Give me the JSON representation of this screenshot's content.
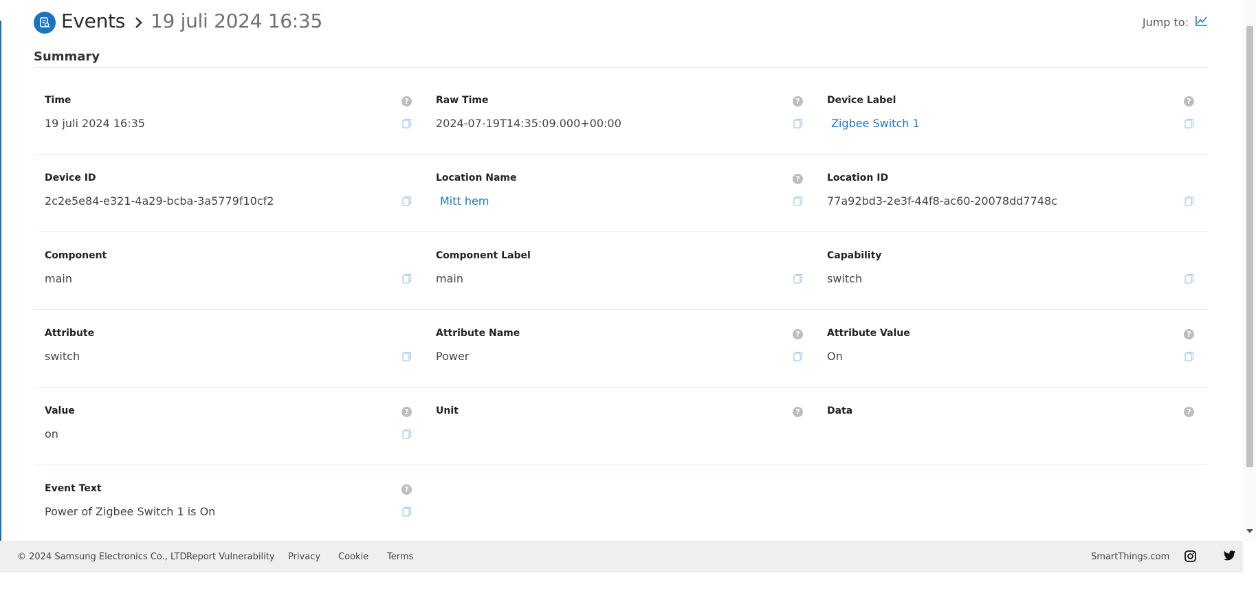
{
  "header": {
    "title": "Events",
    "subtitle": "19 juli 2024 16:35",
    "jump_label": "Jump to:"
  },
  "section": {
    "title": "Summary"
  },
  "fields": [
    [
      {
        "label": "Time",
        "value": "19 juli 2024 16:35",
        "help": true,
        "link": false
      },
      {
        "label": "Raw Time",
        "value": "2024-07-19T14:35:09.000+00:00",
        "help": true,
        "link": false
      },
      {
        "label": "Device Label",
        "value": "Zigbee Switch 1",
        "help": true,
        "link": true
      }
    ],
    [
      {
        "label": "Device ID",
        "value": "2c2e5e84-e321-4a29-bcba-3a5779f10cf2",
        "help": false,
        "link": false
      },
      {
        "label": "Location Name",
        "value": "Mitt hem",
        "help": true,
        "link": true
      },
      {
        "label": "Location ID",
        "value": "77a92bd3-2e3f-44f8-ac60-20078dd7748c",
        "help": false,
        "link": false
      }
    ],
    [
      {
        "label": "Component",
        "value": "main",
        "help": false,
        "link": false
      },
      {
        "label": "Component Label",
        "value": "main",
        "help": false,
        "link": false
      },
      {
        "label": "Capability",
        "value": "switch",
        "help": false,
        "link": false
      }
    ],
    [
      {
        "label": "Attribute",
        "value": "switch",
        "help": false,
        "link": false
      },
      {
        "label": "Attribute Name",
        "value": "Power",
        "help": true,
        "link": false
      },
      {
        "label": "Attribute Value",
        "value": "On",
        "help": true,
        "link": false
      }
    ],
    [
      {
        "label": "Value",
        "value": "on",
        "help": true,
        "link": false
      },
      {
        "label": "Unit",
        "value": "",
        "help": true,
        "link": false
      },
      {
        "label": "Data",
        "value": "",
        "help": true,
        "link": false
      }
    ],
    [
      {
        "label": "Event Text",
        "value": "Power of Zigbee Switch 1 is On",
        "help": true,
        "link": false
      }
    ]
  ],
  "footer": {
    "copyright": "© 2024 Samsung Electronics Co., LTD.",
    "links": [
      "Report Vulnerability",
      "Privacy",
      "Cookie",
      "Terms"
    ],
    "site": "SmartThings.com"
  },
  "colors": {
    "accent": "#1a74c4",
    "link": "#1a74c4",
    "footer_bg": "#efefef"
  },
  "icons": {
    "logo": "events-logo-icon",
    "jump": "chart-icon",
    "help": "help-icon",
    "copy": "copy-icon",
    "social": [
      "instagram-icon",
      "twitter-icon"
    ]
  }
}
